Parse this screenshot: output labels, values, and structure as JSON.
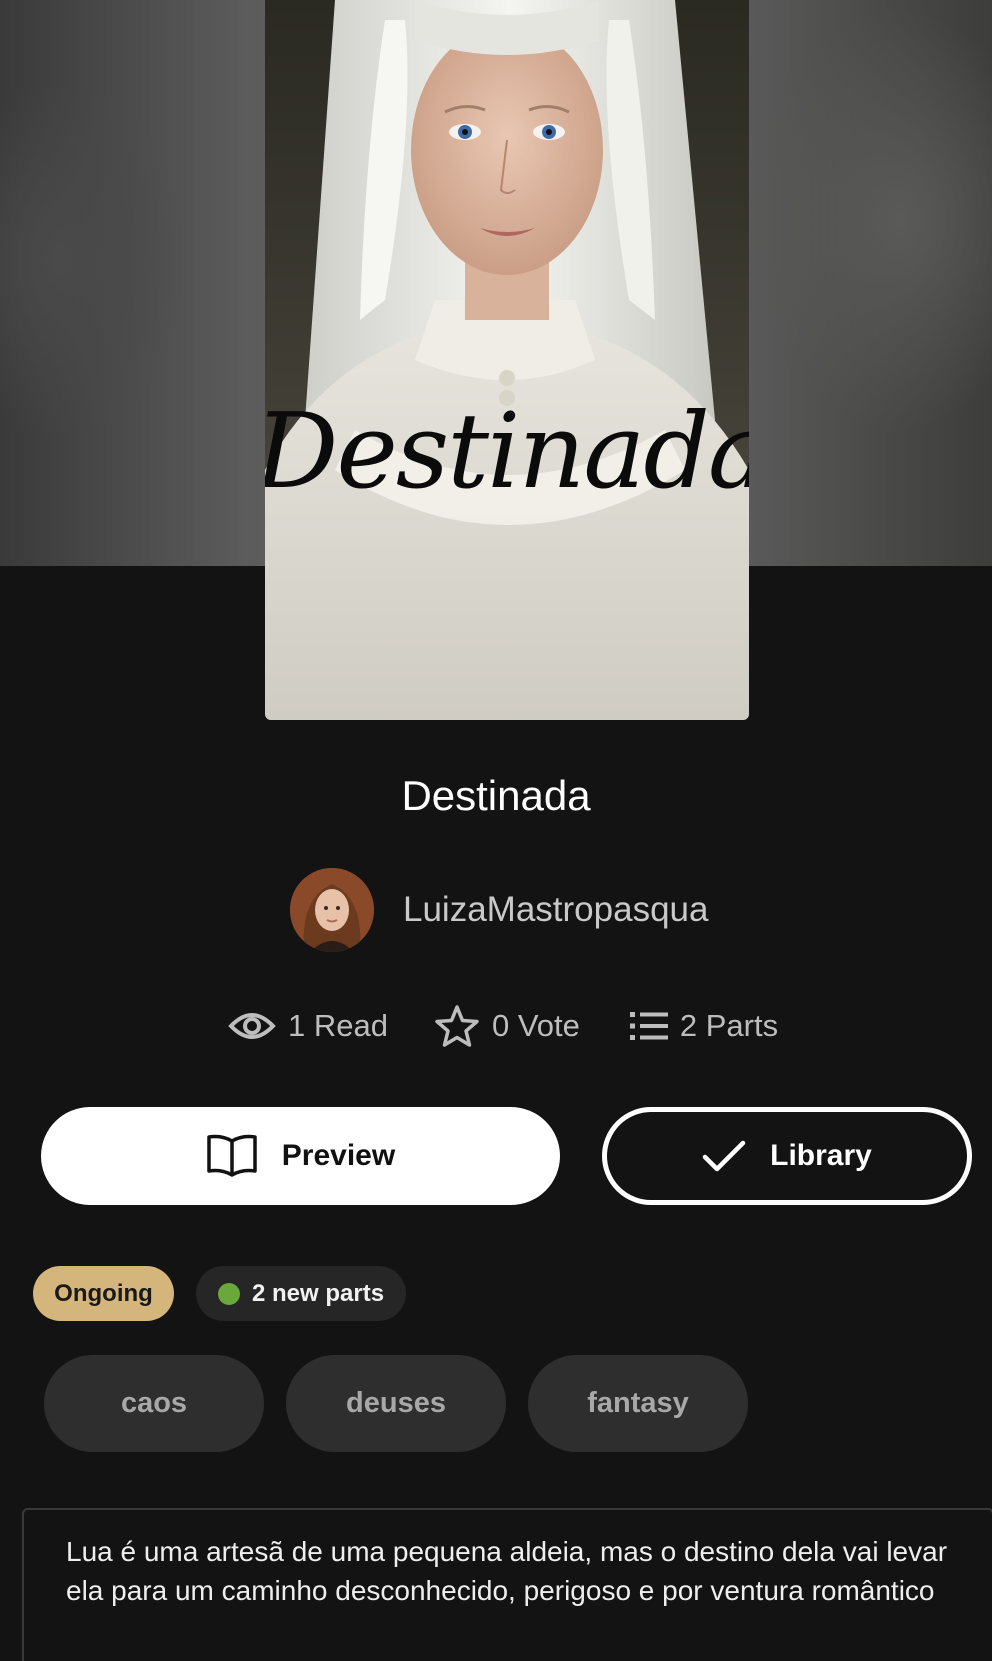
{
  "story": {
    "cover_text": "Destinada",
    "title": "Destinada",
    "author": "LuizaMastropasqua",
    "stats": {
      "reads": "1 Read",
      "votes": "0 Vote",
      "parts": "2 Parts"
    },
    "actions": {
      "preview_label": "Preview",
      "library_label": "Library"
    },
    "badges": {
      "status": "Ongoing",
      "new_parts": "2 new parts"
    },
    "tags": [
      "caos",
      "deuses",
      "fantasy"
    ],
    "description": "Lua é uma artesã de uma pequena aldeia, mas o destino dela vai levar ela para um caminho desconhecido, perigoso e por ventura romântico"
  },
  "colors": {
    "background": "#131313",
    "ongoing_badge": "#d4b57c",
    "new_parts_dot": "#6aa83a",
    "tag_background": "#2e2e2e"
  },
  "icons": {
    "reads": "eye-icon",
    "votes": "star-icon",
    "parts": "list-icon",
    "preview": "open-book-icon",
    "library": "checkmark-icon"
  }
}
